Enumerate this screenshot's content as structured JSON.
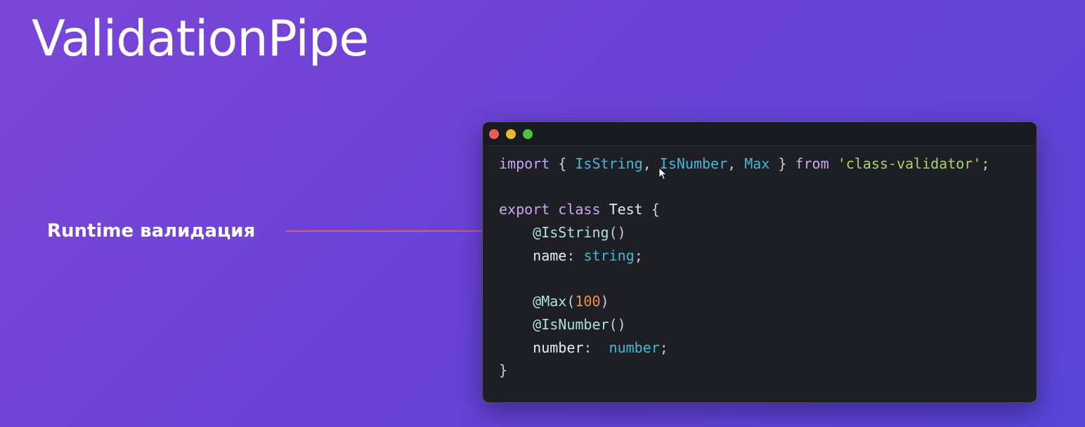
{
  "slide": {
    "title": "ValidationPipe",
    "callout_label": "Runtime валидация"
  },
  "colors": {
    "background_start": "#7b46d6",
    "background_end": "#5a45d8",
    "arrow": "#f0676c",
    "window_background": "#1e1f25",
    "traffic_close": "#ed5f56",
    "traffic_minimize": "#e8b92d",
    "traffic_maximize": "#4fc140"
  },
  "icons": {
    "window_controls": [
      "close-dot-icon",
      "minimize-dot-icon",
      "maximize-dot-icon"
    ],
    "pointer": "mouse-cursor-icon",
    "callout": "arrow-right-icon"
  },
  "code": {
    "language": "typescript",
    "lines": [
      [
        {
          "t": "import",
          "k": "keyword"
        },
        {
          "t": " { ",
          "k": "punct"
        },
        {
          "t": "IsString",
          "k": "ident"
        },
        {
          "t": ", ",
          "k": "punct"
        },
        {
          "t": "IsNumber",
          "k": "ident"
        },
        {
          "t": ", ",
          "k": "punct"
        },
        {
          "t": "Max",
          "k": "ident"
        },
        {
          "t": " } ",
          "k": "punct"
        },
        {
          "t": "from",
          "k": "keyword"
        },
        {
          "t": " ",
          "k": "punct"
        },
        {
          "t": "'class-validator'",
          "k": "string"
        },
        {
          "t": ";",
          "k": "punct"
        }
      ],
      [],
      [
        {
          "t": "export",
          "k": "keyword"
        },
        {
          "t": " ",
          "k": "punct"
        },
        {
          "t": "class",
          "k": "keyword"
        },
        {
          "t": " ",
          "k": "punct"
        },
        {
          "t": "Test",
          "k": "classname"
        },
        {
          "t": " {",
          "k": "punct"
        }
      ],
      [
        {
          "t": "    ",
          "k": "punct"
        },
        {
          "t": "@IsString",
          "k": "decorator"
        },
        {
          "t": "()",
          "k": "punct"
        }
      ],
      [
        {
          "t": "    ",
          "k": "punct"
        },
        {
          "t": "name",
          "k": "prop"
        },
        {
          "t": ": ",
          "k": "punct"
        },
        {
          "t": "string",
          "k": "type"
        },
        {
          "t": ";",
          "k": "punct"
        }
      ],
      [],
      [
        {
          "t": "    ",
          "k": "punct"
        },
        {
          "t": "@Max",
          "k": "decorator"
        },
        {
          "t": "(",
          "k": "punct"
        },
        {
          "t": "100",
          "k": "number"
        },
        {
          "t": ")",
          "k": "punct"
        }
      ],
      [
        {
          "t": "    ",
          "k": "punct"
        },
        {
          "t": "@IsNumber",
          "k": "decorator"
        },
        {
          "t": "()",
          "k": "punct"
        }
      ],
      [
        {
          "t": "    ",
          "k": "punct"
        },
        {
          "t": "number",
          "k": "prop"
        },
        {
          "t": ":  ",
          "k": "punct"
        },
        {
          "t": "number",
          "k": "type"
        },
        {
          "t": ";",
          "k": "punct"
        }
      ],
      [
        {
          "t": "}",
          "k": "punct"
        }
      ]
    ]
  }
}
